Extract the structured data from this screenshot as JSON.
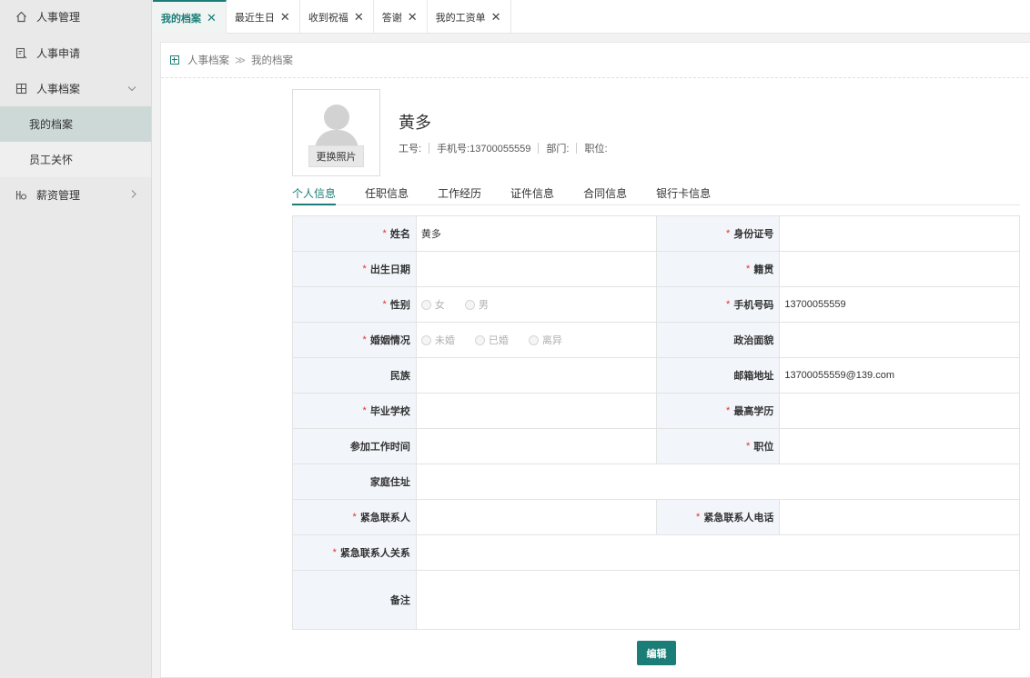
{
  "sidebar": {
    "title": "人事管理",
    "items": [
      {
        "label": "人事申请"
      },
      {
        "label": "人事档案"
      },
      {
        "label": "薪资管理"
      }
    ],
    "subitems": [
      {
        "label": "我的档案"
      },
      {
        "label": "员工关怀"
      }
    ]
  },
  "tabs": [
    {
      "label": "我的档案"
    },
    {
      "label": "最近生日"
    },
    {
      "label": "收到祝福"
    },
    {
      "label": "答谢"
    },
    {
      "label": "我的工资单"
    }
  ],
  "breadcrumb": {
    "root": "人事档案",
    "separator": "≫",
    "current": "我的档案"
  },
  "profile": {
    "change_photo": "更换照片",
    "name": "黄多",
    "emp_no": "工号:",
    "phone": "手机号:13700055559",
    "dept": "部门:",
    "position": "职位:"
  },
  "subtabs": [
    {
      "label": "个人信息"
    },
    {
      "label": "任职信息"
    },
    {
      "label": "工作经历"
    },
    {
      "label": "证件信息"
    },
    {
      "label": "合同信息"
    },
    {
      "label": "银行卡信息"
    }
  ],
  "form": {
    "required_mark": "*",
    "name_label": "姓名",
    "name_value": "黄多",
    "id_label": "身份证号",
    "id_value": "",
    "birth_label": "出生日期",
    "birth_value": "",
    "native_label": "籍贯",
    "native_value": "",
    "gender_label": "性别",
    "gender_options": [
      "女",
      "男"
    ],
    "mobile_label": "手机号码",
    "mobile_value": "13700055559",
    "marital_label": "婚姻情况",
    "marital_options": [
      "未婚",
      "已婚",
      "离异"
    ],
    "political_label": "政治面貌",
    "political_value": "",
    "ethnic_label": "民族",
    "ethnic_value": "",
    "email_label": "邮箱地址",
    "email_value": "13700055559@139.com",
    "school_label": "毕业学校",
    "school_value": "",
    "edu_label": "最高学历",
    "edu_value": "",
    "workstart_label": "参加工作时间",
    "workstart_value": "",
    "job_label": "职位",
    "job_value": "",
    "address_label": "家庭住址",
    "address_value": "",
    "contact_label": "紧急联系人",
    "contact_value": "",
    "contact_phone_label": "紧急联系人电话",
    "contact_phone_value": "",
    "contact_rel_label": "紧急联系人关系",
    "contact_rel_value": "",
    "remark_label": "备注",
    "remark_value": ""
  },
  "edit_button": "编辑",
  "colors": {
    "accent": "#1b7d77",
    "required": "#e0332e",
    "label_bg": "#f2f5fa"
  }
}
